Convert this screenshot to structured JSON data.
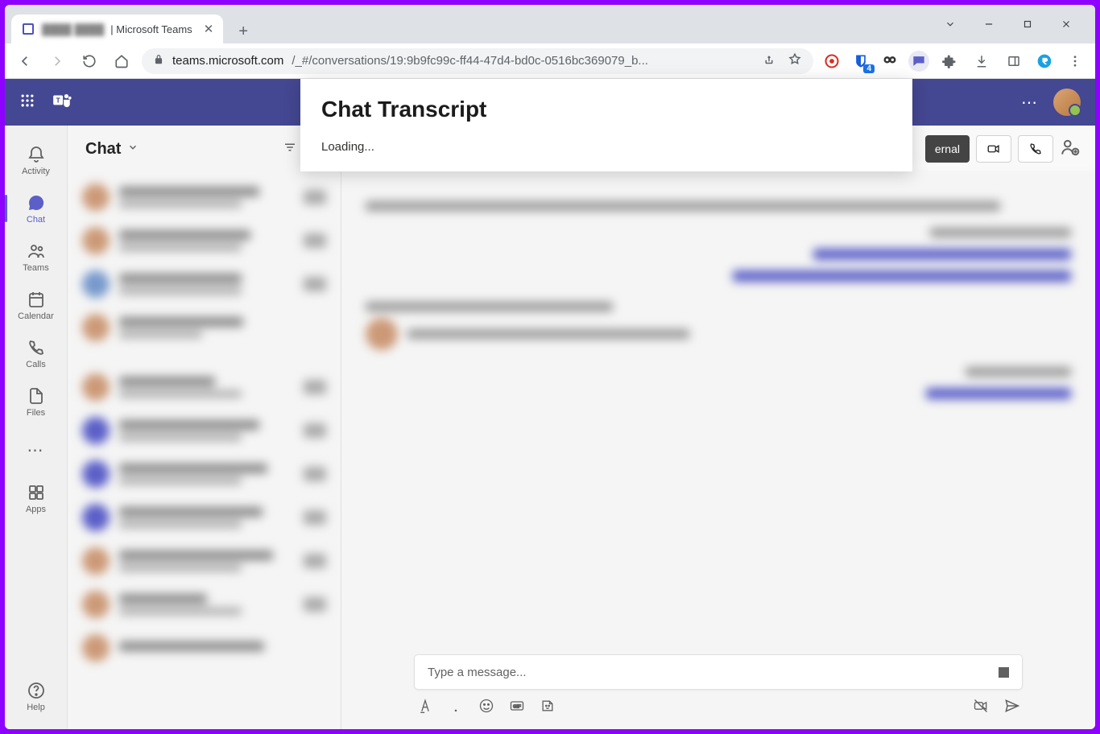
{
  "browser": {
    "tab_title_suffix": "| Microsoft Teams",
    "url_domain": "teams.microsoft.com",
    "url_path": "/_#/conversations/19:9b9fc99c-ff44-47d4-bd0c-0516bc369079_b...",
    "ext_badge": "4"
  },
  "popup": {
    "title": "Chat Transcript",
    "status": "Loading..."
  },
  "rail": {
    "activity": "Activity",
    "chat": "Chat",
    "teams": "Teams",
    "calendar": "Calendar",
    "calls": "Calls",
    "files": "Files",
    "apps": "Apps",
    "help": "Help"
  },
  "chatlist": {
    "heading": "Chat"
  },
  "conv": {
    "external_btn": "ernal"
  },
  "composer": {
    "placeholder": "Type a message..."
  }
}
